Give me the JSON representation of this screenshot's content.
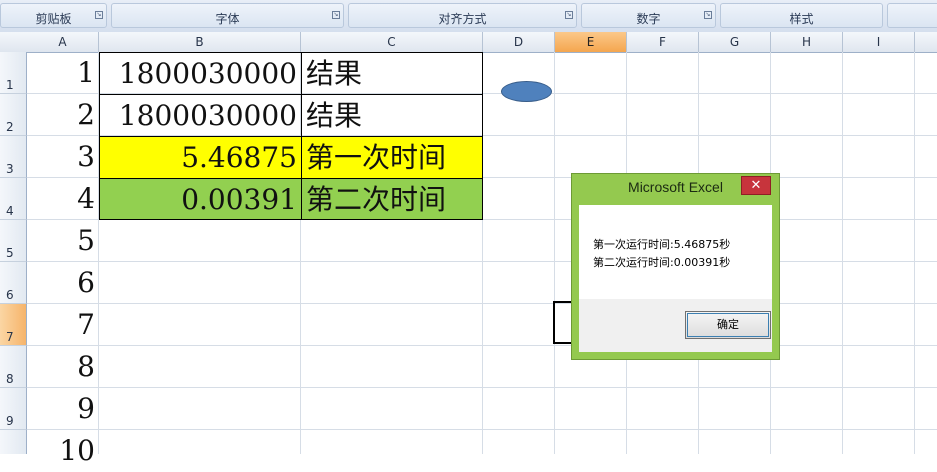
{
  "ribbon": {
    "groups": [
      "剪贴板",
      "字体",
      "对齐方式",
      "数字",
      "样式"
    ]
  },
  "columns": [
    "A",
    "B",
    "C",
    "D",
    "E",
    "F",
    "G",
    "H",
    "I"
  ],
  "selected_column": "E",
  "rows": [
    "1",
    "2",
    "3",
    "4",
    "5",
    "6",
    "7",
    "8",
    "9"
  ],
  "selected_row": "7",
  "cells": {
    "A": [
      "1",
      "2",
      "3",
      "4",
      "5",
      "6",
      "7",
      "8",
      "9",
      "10"
    ],
    "B1": "1800030000",
    "C1": "结果",
    "B2": "1800030000",
    "C2": "结果",
    "B3": "5.46875",
    "C3": "第一次时间",
    "B4": "0.00391",
    "C4": "第二次时间"
  },
  "colors": {
    "row3_fill": "#ffff00",
    "row4_fill": "#92d050",
    "shape_fill": "#4f81bd",
    "dialog_frame": "#94c94f",
    "close_button": "#c7343c"
  },
  "dialog": {
    "title": "Microsoft Excel",
    "close_glyph": "✕",
    "line1": "第一次运行时间:5.46875秒",
    "line2": "第二次运行时间:0.00391秒",
    "ok_label": "确定"
  }
}
